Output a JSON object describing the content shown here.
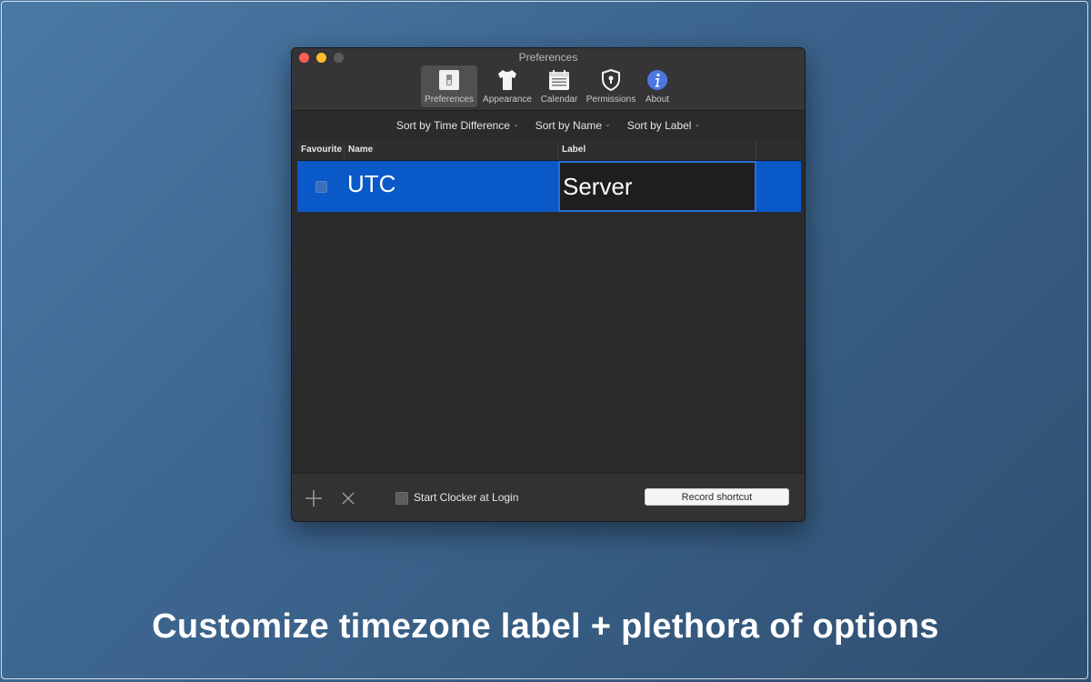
{
  "window": {
    "title": "Preferences",
    "toolbar": [
      {
        "label": "Preferences",
        "icon": "switch-icon"
      },
      {
        "label": "Appearance",
        "icon": "tshirt-icon"
      },
      {
        "label": "Calendar",
        "icon": "calendar-icon"
      },
      {
        "label": "Permissions",
        "icon": "shield-icon"
      },
      {
        "label": "About",
        "icon": "info-icon"
      }
    ]
  },
  "sort": {
    "time_difference": "Sort by Time Difference",
    "name": "Sort by Name",
    "label": "Sort by Label",
    "chevron": "⌄"
  },
  "table": {
    "columns": {
      "favourite": "Favourite",
      "name": "Name",
      "label": "Label"
    },
    "rows": [
      {
        "name": "UTC",
        "label": "Server",
        "favourite": false
      }
    ]
  },
  "bottom": {
    "start_at_login": "Start Clocker at Login",
    "record_shortcut": "Record shortcut"
  },
  "caption": "Customize timezone label + plethora of options",
  "colors": {
    "selection": "#0a59c8",
    "background_gradient_start": "#4a7aa5",
    "background_gradient_end": "#2f4f70"
  }
}
